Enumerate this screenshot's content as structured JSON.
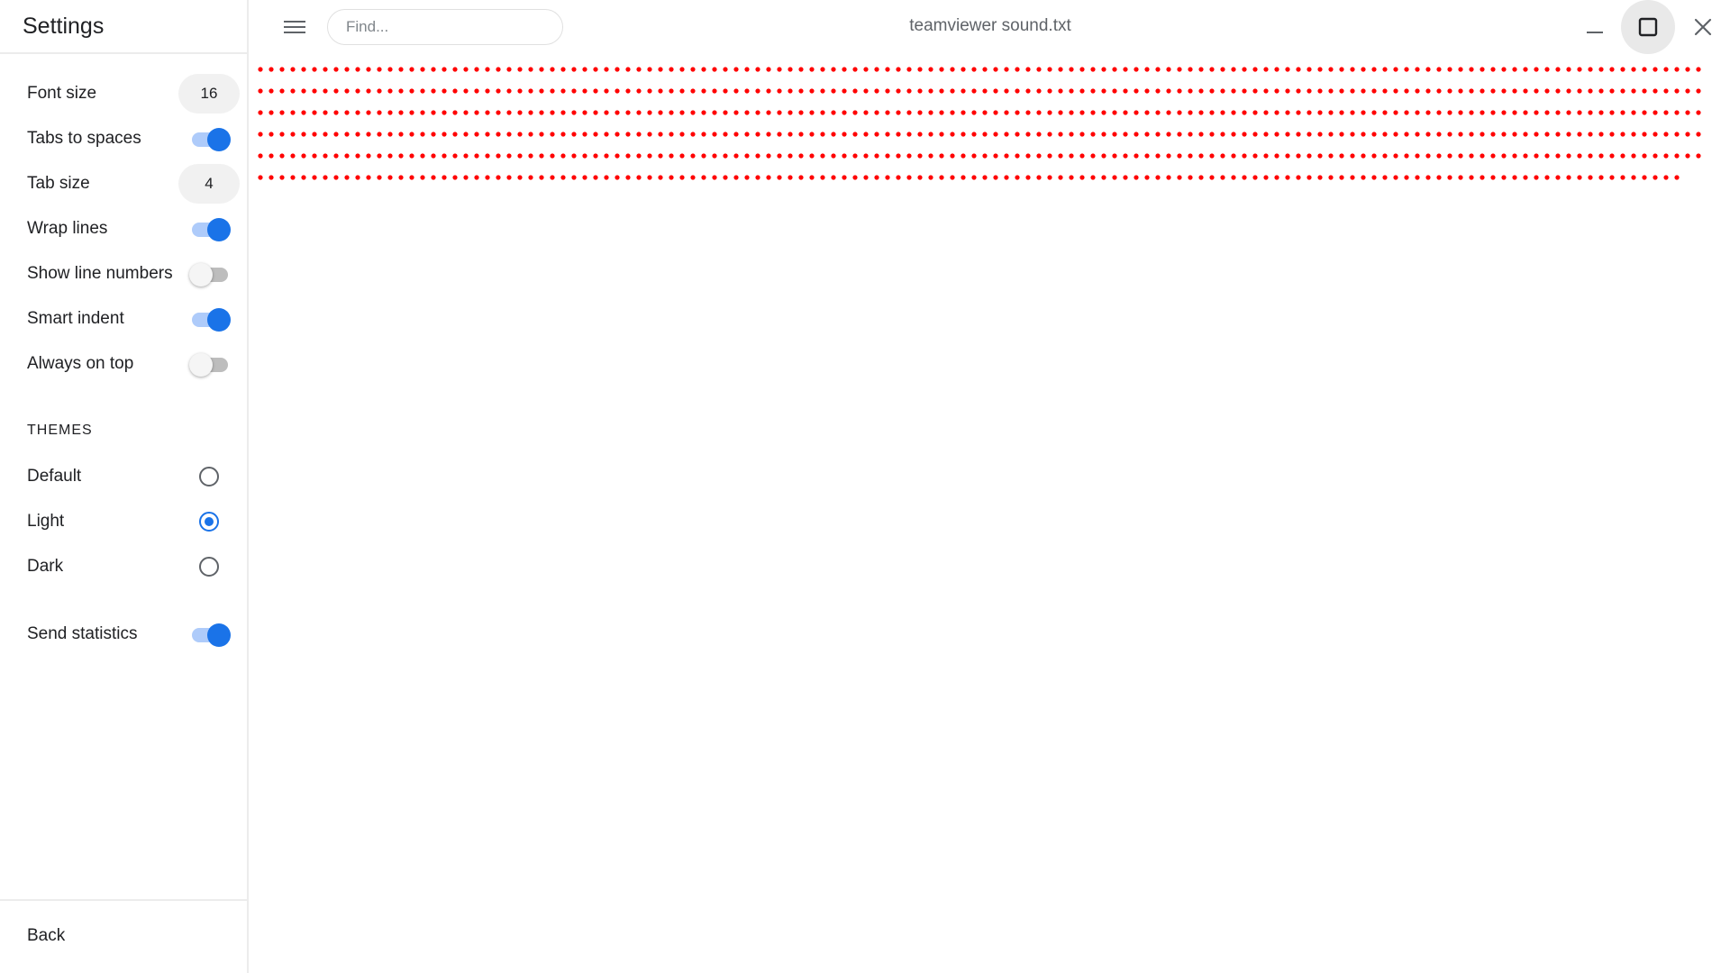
{
  "sidebar": {
    "title": "Settings",
    "font_size": {
      "label": "Font size",
      "value": "16"
    },
    "tabs_to_spaces": {
      "label": "Tabs to spaces",
      "on": true
    },
    "tab_size": {
      "label": "Tab size",
      "value": "4"
    },
    "wrap_lines": {
      "label": "Wrap lines",
      "on": true
    },
    "show_line_numbers": {
      "label": "Show line numbers",
      "on": false
    },
    "smart_indent": {
      "label": "Smart indent",
      "on": true
    },
    "always_on_top": {
      "label": "Always on top",
      "on": false
    },
    "themes_heading": "THEMES",
    "themes": [
      {
        "label": "Default",
        "selected": false
      },
      {
        "label": "Light",
        "selected": true
      },
      {
        "label": "Dark",
        "selected": false
      }
    ],
    "send_statistics": {
      "label": "Send statistics",
      "on": true
    },
    "back_label": "Back"
  },
  "topbar": {
    "menu_icon": "hamburger-menu-icon",
    "search_placeholder": "Find...",
    "file_title": "teamviewer sound.txt",
    "minimize_icon": "minimize-icon",
    "maximize_icon": "maximize-icon",
    "close_icon": "close-icon"
  },
  "editor": {
    "content_note": "six lines of red dotted characters",
    "line_dot_counts": [
      134,
      134,
      134,
      134,
      134,
      132
    ],
    "dot_color": "#ff0000"
  },
  "colors": {
    "accent": "#1a73e8",
    "accent_light": "#aecbfa"
  }
}
